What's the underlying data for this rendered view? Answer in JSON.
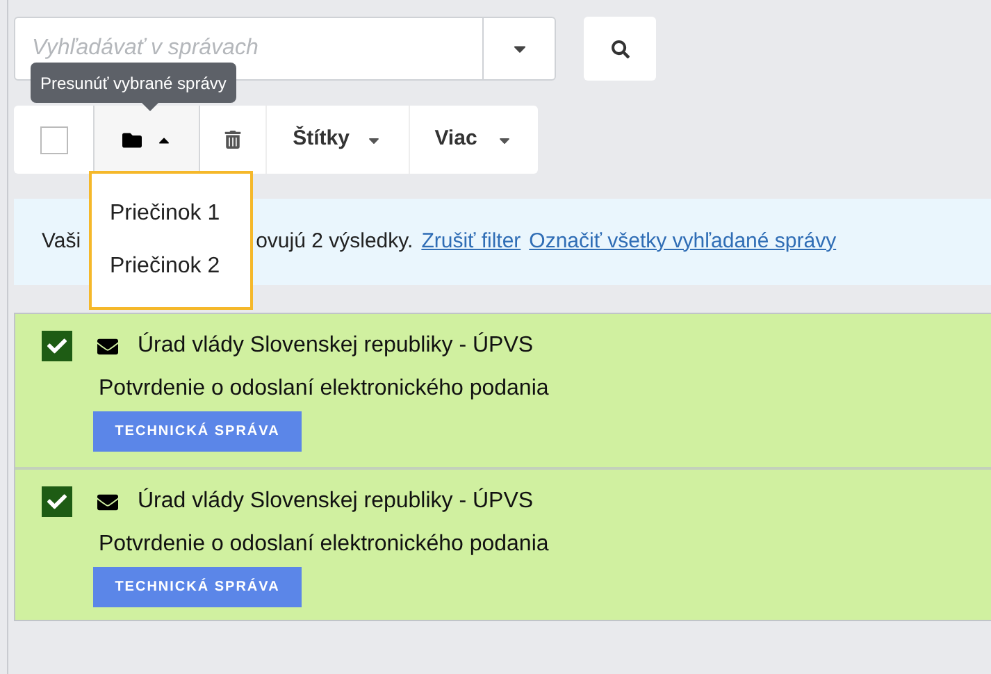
{
  "search": {
    "placeholder": "Vyhľadávať v správach"
  },
  "tooltip": "Presunúť vybrané správy",
  "toolbar": {
    "select_all_checked": false,
    "labels_button": "Štítky",
    "more_button": "Viac"
  },
  "folder_menu": {
    "expanded": true,
    "items": [
      "Priečinok 1",
      "Priečinok 2"
    ]
  },
  "info_bar": {
    "text_before": "Vaši",
    "text_after": "ovujú 2 výsledky.",
    "links": [
      "Zrušiť filter",
      "Označiť všetky vyhľadané správy"
    ]
  },
  "messages": [
    {
      "checked": true,
      "sender": "Úrad vlády Slovenskej republiky - ÚPVS",
      "subject": "Potvrdenie o odoslaní elektronického podania",
      "tags": [
        "TECHNICKÁ SPRÁVA"
      ]
    },
    {
      "checked": true,
      "sender": "Úrad vlády Slovenskej republiky - ÚPVS",
      "subject": "Potvrdenie o odoslaní elektronického podania",
      "tags": [
        "TECHNICKÁ SPRÁVA"
      ]
    }
  ]
}
